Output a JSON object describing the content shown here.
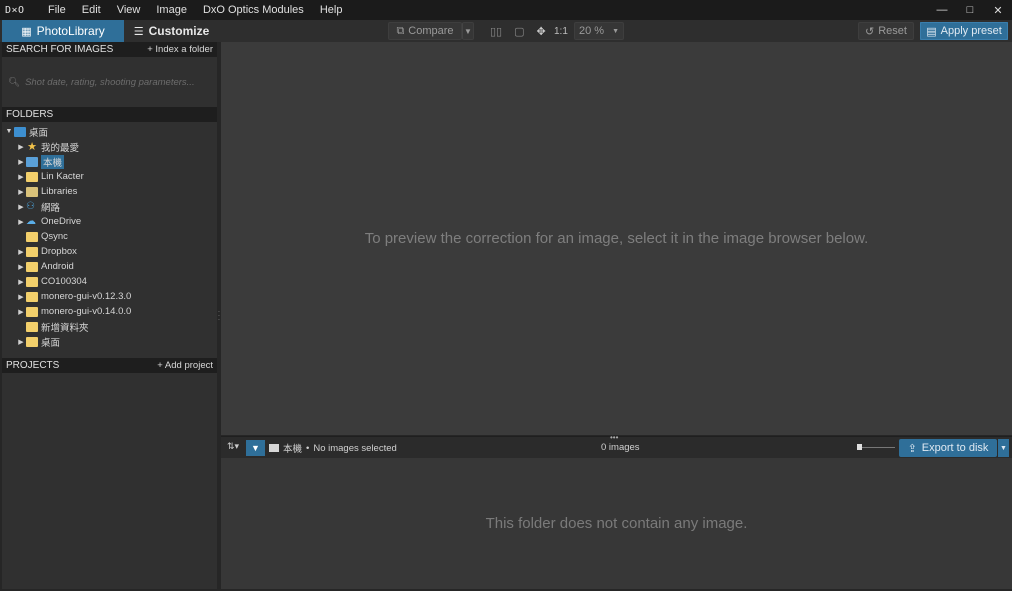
{
  "app": {
    "logo": "D×O"
  },
  "menu": [
    "File",
    "Edit",
    "View",
    "Image",
    "DxO Optics Modules",
    "Help"
  ],
  "window_controls": {
    "minimize": "—",
    "maximize": "□",
    "close": "✕"
  },
  "toolbar": {
    "tab_photolibrary": "PhotoLibrary",
    "tab_customize": "Customize",
    "compare_label": "Compare",
    "zoom_1to1": "1:1",
    "zoom_value": "20 %",
    "reset_label": "Reset",
    "apply_preset_label": "Apply preset"
  },
  "sidebar": {
    "search_header": "SEARCH FOR IMAGES",
    "index_folder": "+ Index a folder",
    "search_placeholder": "Shot date, rating, shooting parameters...",
    "folders_header": "FOLDERS",
    "tree": [
      {
        "label": "桌面",
        "icon": "desktop-icon",
        "expanded": true
      },
      {
        "label": "我的最愛",
        "icon": "star-icon"
      },
      {
        "label": "本機",
        "icon": "computer-icon",
        "selected": true
      },
      {
        "label": "Lin Kacter",
        "icon": "folder-icon"
      },
      {
        "label": "Libraries",
        "icon": "libraries-icon"
      },
      {
        "label": "網路",
        "icon": "network-icon"
      },
      {
        "label": "OneDrive",
        "icon": "cloud-icon"
      },
      {
        "label": "Qsync",
        "icon": "folder-icon"
      },
      {
        "label": "Dropbox",
        "icon": "folder-icon"
      },
      {
        "label": "Android",
        "icon": "folder-icon"
      },
      {
        "label": "CO100304",
        "icon": "folder-icon"
      },
      {
        "label": "monero-gui-v0.12.3.0",
        "icon": "folder-icon"
      },
      {
        "label": "monero-gui-v0.14.0.0",
        "icon": "folder-icon"
      },
      {
        "label": "新增資料夾",
        "icon": "folder-icon"
      },
      {
        "label": "桌面",
        "icon": "folder-icon"
      }
    ],
    "projects_header": "PROJECTS",
    "add_project": "+ Add project"
  },
  "preview": {
    "message": "To preview the correction for an image, select it in the image browser below."
  },
  "browser_bar": {
    "path": "本機",
    "separator": "•",
    "selection_status": "No images selected",
    "image_count": "0 images",
    "export_label": "Export to disk"
  },
  "browser": {
    "message": "This folder does not contain any image."
  },
  "colors": {
    "accent": "#2f6f99",
    "panel": "#303030",
    "background": "#3b3b3b",
    "folder": "#f2cf6b"
  }
}
